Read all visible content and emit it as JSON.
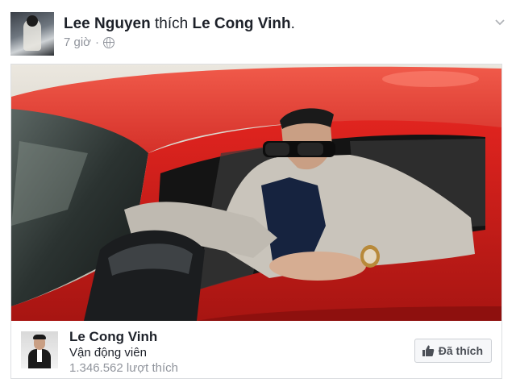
{
  "post": {
    "actor_name": "Lee Nguyen",
    "verb": "thích",
    "target_name": "Le Cong Vinh",
    "period": ".",
    "time": "7 giờ",
    "separator": "·",
    "privacy_icon": "globe-icon",
    "menu_icon": "chevron-down-icon"
  },
  "page_card": {
    "name": "Le Cong Vinh",
    "category": "Vận động viên",
    "likes": "1.346.562 lượt thích",
    "button_label": "Đã thích",
    "button_icon": "thumbs-up-icon"
  },
  "colors": {
    "link_blue": "#4267b2",
    "meta_gray": "#90949c",
    "car_red": "#d8231f"
  }
}
